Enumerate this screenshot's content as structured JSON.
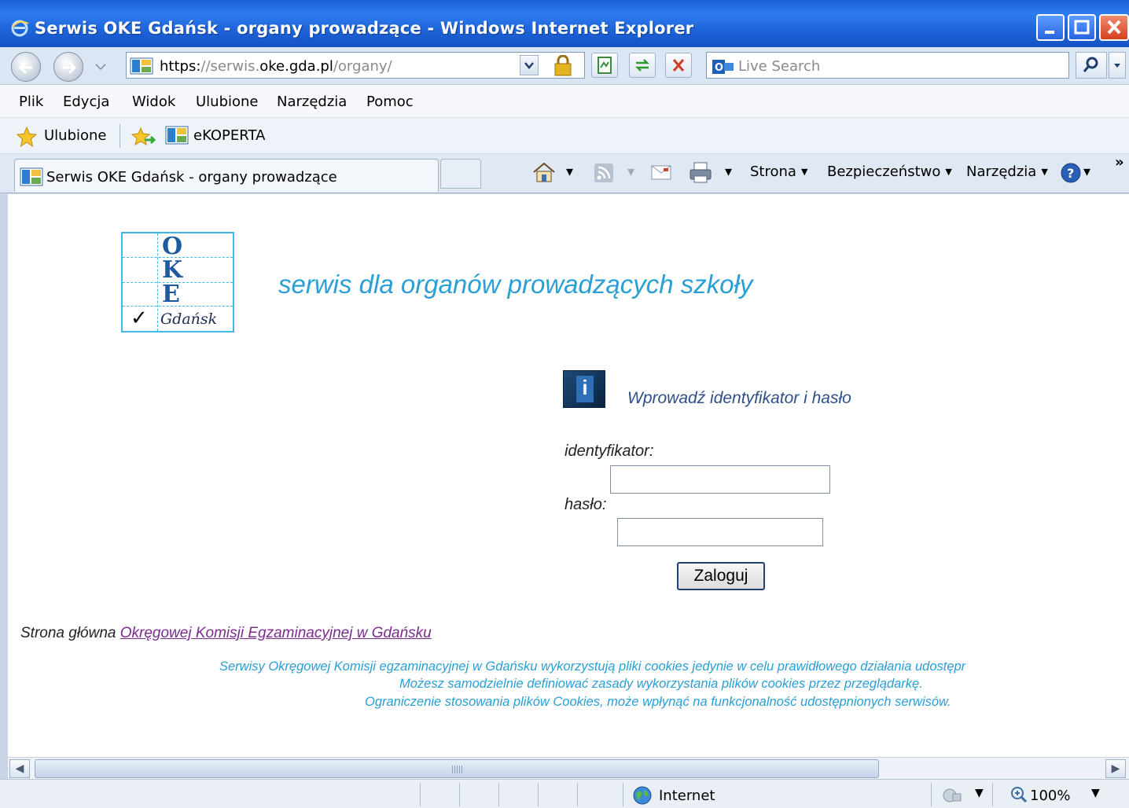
{
  "window": {
    "title": "Serwis OKE Gdańsk - organy prowadzące - Windows Internet Explorer"
  },
  "addressbar": {
    "url_scheme": "https:",
    "url_sep": "//",
    "url_sub": "serwis.",
    "url_domain": "oke.gda.pl",
    "url_path": "/organy/",
    "search_placeholder": "Live Search"
  },
  "menu": {
    "items": [
      "Plik",
      "Edycja",
      "Widok",
      "Ulubione",
      "Narzędzia",
      "Pomoc"
    ]
  },
  "favorites": {
    "label": "Ulubione",
    "link": "eKOPERTA"
  },
  "tabs": {
    "active_title": "Serwis OKE Gdańsk - organy prowadzące"
  },
  "commandbar": {
    "page": "Strona",
    "security": "Bezpieczeństwo",
    "tools": "Narzędzia",
    "more": "»"
  },
  "page": {
    "logo": {
      "letters": [
        "O",
        "K",
        "E"
      ],
      "city": "Gdańsk",
      "check": "✓"
    },
    "headline": "serwis dla organów prowadzących szkoły",
    "info_text": "Wprowadź identyfikator i hasło",
    "login": {
      "id_label": "identyfikator:",
      "id_value": "",
      "pass_label": "hasło:",
      "pass_value": "",
      "button": "Zaloguj"
    },
    "home_prefix": "Strona główna ",
    "home_link": "Okręgowej Komisji Egzaminacyjnej w Gdańsku",
    "cookies": [
      "Serwisy Okręgowej Komisji egzaminacyjnej w Gdańsku wykorzystują pliki cookies jedynie w celu prawidłowego działania udostępr",
      "Możesz samodzielnie definiować zasady wykorzystania plików cookies przez przeglądarkę.",
      "Ograniczenie stosowania plików Cookies, może wpłynąć na funkcjonalność udostępnionych serwisów."
    ]
  },
  "statusbar": {
    "zone": "Internet",
    "zoom": "100%"
  },
  "colors": {
    "titlebar": "#1e63d8",
    "headline": "#2a9fd6",
    "link": "#7a2c8e",
    "cookie_text": "#2a9fd6"
  }
}
